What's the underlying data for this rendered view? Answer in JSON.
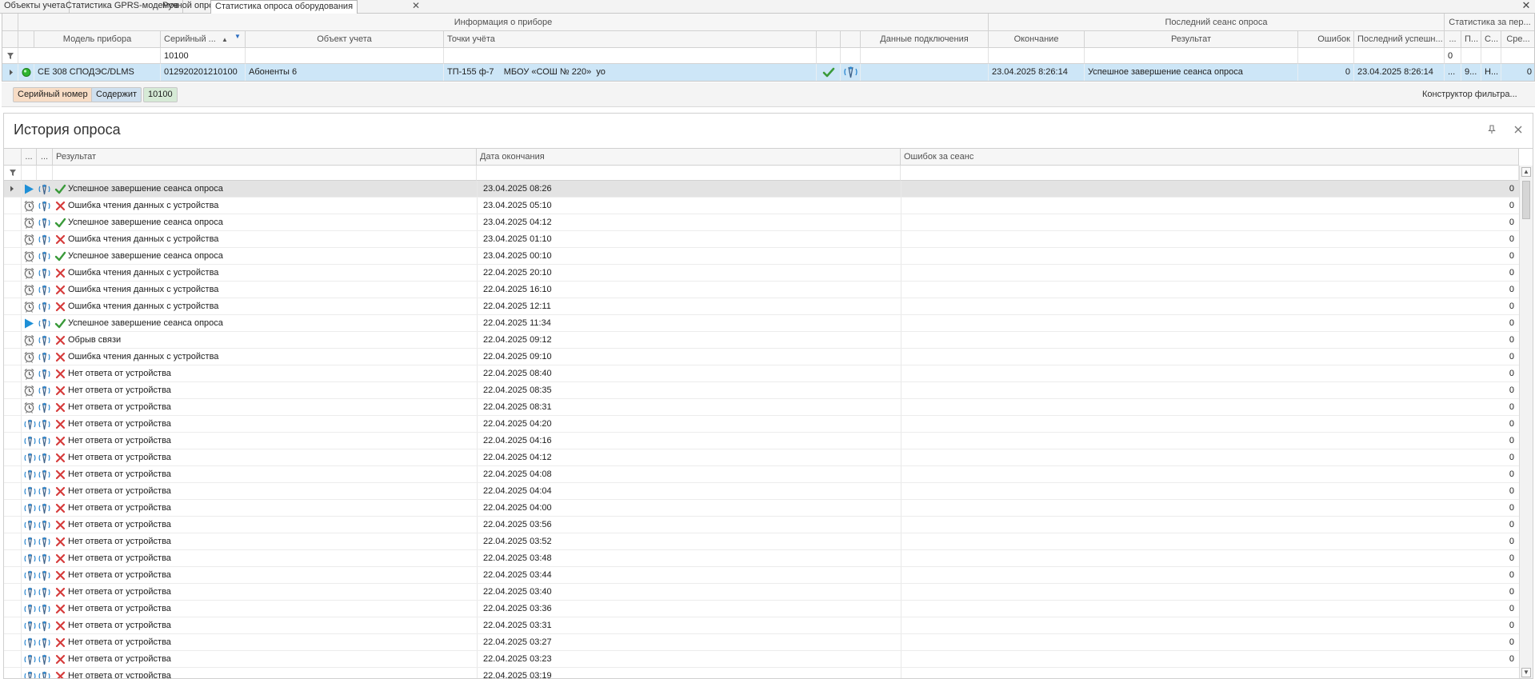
{
  "tabs": [
    {
      "label": "Объекты учета"
    },
    {
      "label": "Статистика GPRS-модемов"
    },
    {
      "label": "Ручной опрос"
    },
    {
      "label": "Статистика опроса оборудования"
    }
  ],
  "tab_close_glyph": "✕",
  "window_close_glyph": "✕",
  "upper_grid": {
    "bands": {
      "device_info": "Информация о приборе",
      "last_session": "Последний сеанс опроса",
      "period_stats": "Статистика за пер..."
    },
    "columns": {
      "model": "Модель прибора",
      "serial": "Серийный ...",
      "sort_indicator": "▲",
      "filter_indicator": "▼",
      "object": "Объект учета",
      "points": "Точки учёта",
      "connection": "Данные подключения",
      "end": "Окончание",
      "result": "Результат",
      "errors": "Ошибок",
      "last_success": "Последний успешн...",
      "dots": "...",
      "p": "П...",
      "s": "С...",
      "avg": "Сре..."
    },
    "filter_row": {
      "serial": "10100",
      "period_value": "0"
    },
    "row": {
      "model": "СЕ 308 СПОДЭС/DLMS",
      "serial": "012920201210100",
      "object": "Абоненты 6",
      "points": "ТП-155 ф-7    МБОУ «СОШ № 220»  уо",
      "end": "23.04.2025 8:26:14",
      "result": "Успешное завершение сеанса опроса",
      "errors": "0",
      "last_success": "23.04.2025 8:26:14",
      "dots": "...",
      "p": "9...",
      "s": "Н...",
      "avg": "0"
    }
  },
  "filter_panel": {
    "chip_field": "Серийный номер",
    "chip_op": "Содержит",
    "chip_value": "10100",
    "constructor": "Конструктор фильтра..."
  },
  "history": {
    "title": "История опроса",
    "columns": {
      "c1": "...",
      "c2": "...",
      "result": "Результат",
      "end_date": "Дата окончания",
      "errors": "Ошибок за сеанс"
    },
    "rows": [
      {
        "mode": "manual",
        "status": "ok",
        "result": "Успешное завершение сеанса опроса",
        "date": "23.04.2025 08:26",
        "errors": "0"
      },
      {
        "mode": "schedule",
        "status": "err",
        "result": "Ошибка чтения данных с устройства",
        "date": "23.04.2025 05:10",
        "errors": "0"
      },
      {
        "mode": "schedule",
        "status": "ok",
        "result": "Успешное завершение сеанса опроса",
        "date": "23.04.2025 04:12",
        "errors": "0"
      },
      {
        "mode": "schedule",
        "status": "err",
        "result": "Ошибка чтения данных с устройства",
        "date": "23.04.2025 01:10",
        "errors": "0"
      },
      {
        "mode": "schedule",
        "status": "ok",
        "result": "Успешное завершение сеанса опроса",
        "date": "23.04.2025 00:10",
        "errors": "0"
      },
      {
        "mode": "schedule",
        "status": "err",
        "result": "Ошибка чтения данных с устройства",
        "date": "22.04.2025 20:10",
        "errors": "0"
      },
      {
        "mode": "schedule",
        "status": "err",
        "result": "Ошибка чтения данных с устройства",
        "date": "22.04.2025 16:10",
        "errors": "0"
      },
      {
        "mode": "schedule",
        "status": "err",
        "result": "Ошибка чтения данных с устройства",
        "date": "22.04.2025 12:11",
        "errors": "0"
      },
      {
        "mode": "manual",
        "status": "ok",
        "result": "Успешное завершение сеанса опроса",
        "date": "22.04.2025 11:34",
        "errors": "0"
      },
      {
        "mode": "schedule",
        "status": "err",
        "result": "Обрыв связи",
        "date": "22.04.2025 09:12",
        "errors": "0"
      },
      {
        "mode": "schedule",
        "status": "err",
        "result": "Ошибка чтения данных с устройства",
        "date": "22.04.2025 09:10",
        "errors": "0"
      },
      {
        "mode": "schedule",
        "status": "err",
        "result": "Нет ответа от устройства",
        "date": "22.04.2025 08:40",
        "errors": "0"
      },
      {
        "mode": "schedule",
        "status": "err",
        "result": "Нет ответа от устройства",
        "date": "22.04.2025 08:35",
        "errors": "0"
      },
      {
        "mode": "schedule",
        "status": "err",
        "result": "Нет ответа от устройства",
        "date": "22.04.2025 08:31",
        "errors": "0"
      },
      {
        "mode": "antenna",
        "status": "err",
        "result": "Нет ответа от устройства",
        "date": "22.04.2025 04:20",
        "errors": "0"
      },
      {
        "mode": "antenna",
        "status": "err",
        "result": "Нет ответа от устройства",
        "date": "22.04.2025 04:16",
        "errors": "0"
      },
      {
        "mode": "antenna",
        "status": "err",
        "result": "Нет ответа от устройства",
        "date": "22.04.2025 04:12",
        "errors": "0"
      },
      {
        "mode": "antenna",
        "status": "err",
        "result": "Нет ответа от устройства",
        "date": "22.04.2025 04:08",
        "errors": "0"
      },
      {
        "mode": "antenna",
        "status": "err",
        "result": "Нет ответа от устройства",
        "date": "22.04.2025 04:04",
        "errors": "0"
      },
      {
        "mode": "antenna",
        "status": "err",
        "result": "Нет ответа от устройства",
        "date": "22.04.2025 04:00",
        "errors": "0"
      },
      {
        "mode": "antenna",
        "status": "err",
        "result": "Нет ответа от устройства",
        "date": "22.04.2025 03:56",
        "errors": "0"
      },
      {
        "mode": "antenna",
        "status": "err",
        "result": "Нет ответа от устройства",
        "date": "22.04.2025 03:52",
        "errors": "0"
      },
      {
        "mode": "antenna",
        "status": "err",
        "result": "Нет ответа от устройства",
        "date": "22.04.2025 03:48",
        "errors": "0"
      },
      {
        "mode": "antenna",
        "status": "err",
        "result": "Нет ответа от устройства",
        "date": "22.04.2025 03:44",
        "errors": "0"
      },
      {
        "mode": "antenna",
        "status": "err",
        "result": "Нет ответа от устройства",
        "date": "22.04.2025 03:40",
        "errors": "0"
      },
      {
        "mode": "antenna",
        "status": "err",
        "result": "Нет ответа от устройства",
        "date": "22.04.2025 03:36",
        "errors": "0"
      },
      {
        "mode": "antenna",
        "status": "err",
        "result": "Нет ответа от устройства",
        "date": "22.04.2025 03:31",
        "errors": "0"
      },
      {
        "mode": "antenna",
        "status": "err",
        "result": "Нет ответа от устройства",
        "date": "22.04.2025 03:27",
        "errors": "0"
      },
      {
        "mode": "antenna",
        "status": "err",
        "result": "Нет ответа от устройства",
        "date": "22.04.2025 03:23",
        "errors": "0"
      },
      {
        "mode": "antenna",
        "status": "err",
        "result": "Нет ответа от устройства",
        "date": "22.04.2025 03:19",
        "errors": ""
      }
    ]
  },
  "icons": {
    "filter": "funnel-icon",
    "expand": "expand-arrow-icon",
    "online": "green-status-dot-icon",
    "success": "checkmark-icon",
    "error": "red-x-icon",
    "antenna": "antenna-icon",
    "manual": "play-icon",
    "schedule": "alarm-clock-icon",
    "pin": "pin-icon",
    "close": "close-icon"
  },
  "colors": {
    "selected_row": "#cde6f7",
    "success": "#3a9a3a",
    "error": "#d63c3c",
    "manual_play": "#1e8fd6",
    "chip_field_bg": "#f7dcc5",
    "chip_op_bg": "#cfe0ef",
    "chip_value_bg": "#d6ead6"
  }
}
